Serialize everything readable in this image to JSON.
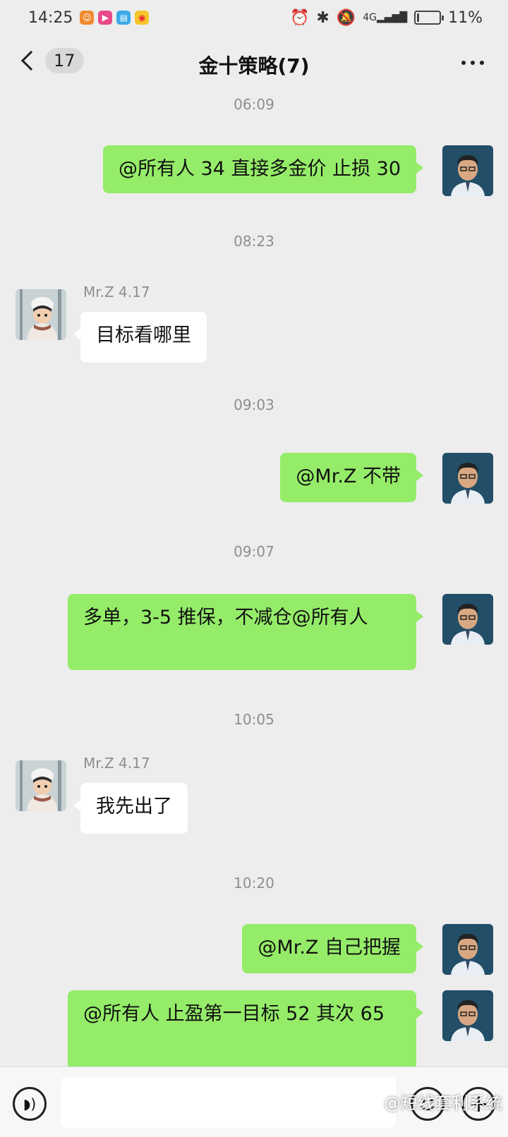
{
  "status_bar": {
    "time": "14:25",
    "network": "4G",
    "battery_percent": "11%",
    "battery_level": 0.11,
    "app_icons": [
      "taobao-icon",
      "video-icon",
      "book-icon",
      "weibo-icon"
    ],
    "system_icons": [
      "alarm-icon",
      "bluetooth-icon",
      "mute-icon",
      "signal-icon",
      "battery-icon"
    ]
  },
  "header": {
    "back_count": "17",
    "title": "金十策略(7)"
  },
  "messages": [
    {
      "type": "timestamp",
      "text": "06:09"
    },
    {
      "type": "message",
      "side": "me",
      "text": "@所有人  34 直接多金价 止损 30"
    },
    {
      "type": "timestamp",
      "text": "08:23"
    },
    {
      "type": "message",
      "side": "other",
      "sender": "Mr.Z 4.17",
      "text": "目标看哪里"
    },
    {
      "type": "timestamp",
      "text": "09:03"
    },
    {
      "type": "message",
      "side": "me",
      "text": "@Mr.Z  不带"
    },
    {
      "type": "timestamp",
      "text": "09:07"
    },
    {
      "type": "message",
      "side": "me",
      "text": "多单，3-5 推保，不减仓@所有人"
    },
    {
      "type": "timestamp",
      "text": "10:05"
    },
    {
      "type": "message",
      "side": "other",
      "sender": "Mr.Z 4.17",
      "text": "我先出了"
    },
    {
      "type": "timestamp",
      "text": "10:20"
    },
    {
      "type": "message",
      "side": "me",
      "text": "@Mr.Z  自己把握"
    },
    {
      "type": "message",
      "side": "me",
      "text": "@所有人   止盈第一目标 52 其次 65"
    }
  ],
  "input_bar": {
    "placeholder": "",
    "watermark": "@短线套利系统"
  },
  "colors": {
    "background": "#ededed",
    "my_bubble": "#95ec69",
    "other_bubble": "#ffffff"
  }
}
